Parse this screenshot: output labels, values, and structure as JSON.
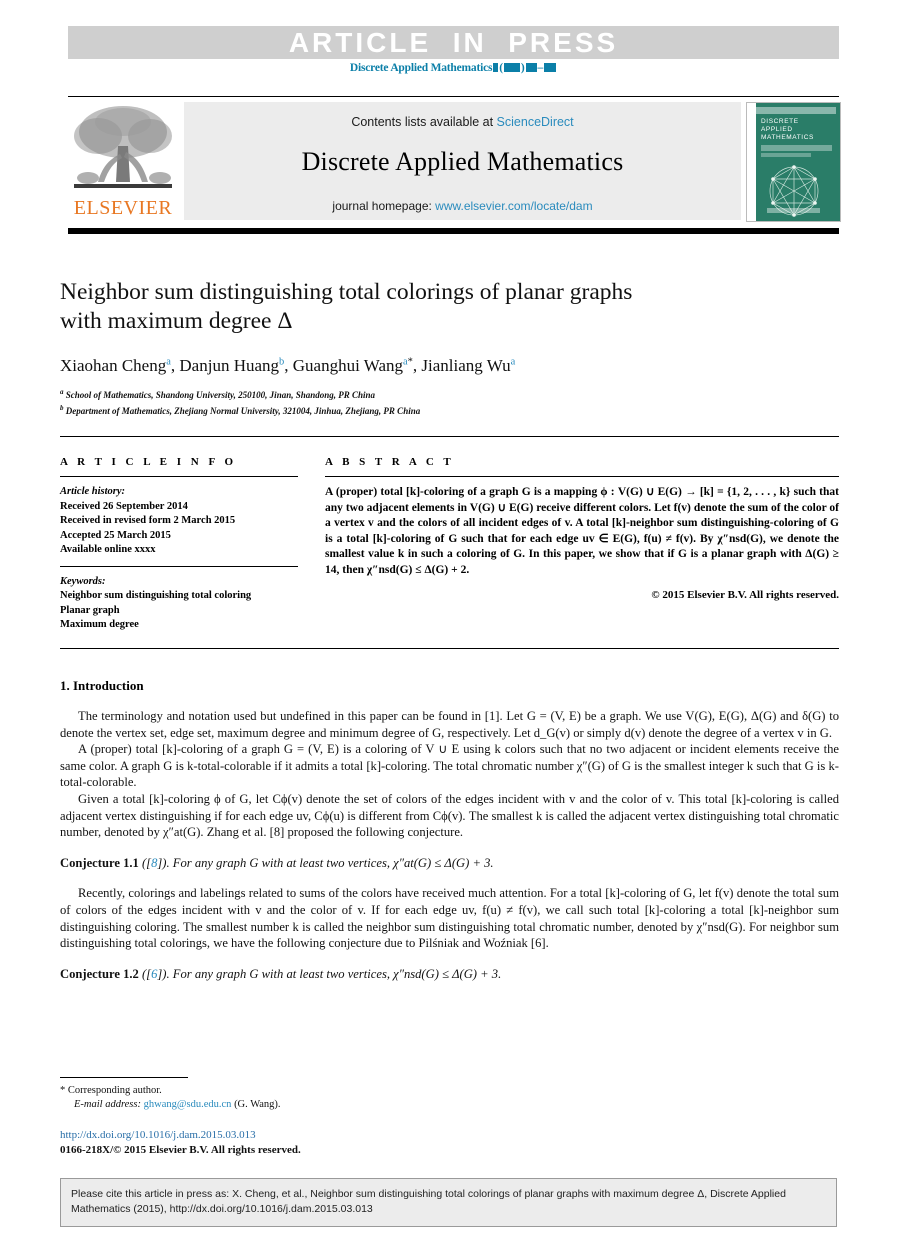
{
  "banner": {
    "article_in_press": "ARTICLE  IN  PRESS",
    "journal_ref_prefix": "Discrete Applied Mathematics"
  },
  "masthead": {
    "contents_prefix": "Contents lists available at ",
    "contents_link": "ScienceDirect",
    "journal_title": "Discrete Applied Mathematics",
    "homepage_prefix": "journal homepage: ",
    "homepage_link": "www.elsevier.com/locate/dam",
    "publisher_logo_text": "ELSEVIER",
    "cover_title_line1": "DISCRETE",
    "cover_title_line2": "APPLIED",
    "cover_title_line3": "MATHEMATICS",
    "cover_color": "#2a7d68"
  },
  "article": {
    "title_line1": "Neighbor sum distinguishing total colorings of planar graphs",
    "title_line2": "with maximum degree Δ",
    "authors": [
      {
        "name": "Xiaohan Cheng",
        "marks": "a",
        "star": false
      },
      {
        "name": "Danjun Huang",
        "marks": "b",
        "star": false
      },
      {
        "name": "Guanghui Wang",
        "marks": "a",
        "star": true
      },
      {
        "name": "Jianliang Wu",
        "marks": "a",
        "star": false
      }
    ],
    "affiliations": [
      {
        "mark": "a",
        "text": "School of Mathematics, Shandong University, 250100, Jinan, Shandong, PR China"
      },
      {
        "mark": "b",
        "text": "Department of Mathematics, Zhejiang Normal University, 321004, Jinhua, Zhejiang, PR China"
      }
    ]
  },
  "article_info": {
    "heading": "A R T I C L E   I N F O",
    "history_label": "Article history:",
    "history": [
      "Received 26 September 2014",
      "Received in revised form 2 March 2015",
      "Accepted 25 March 2015",
      "Available online xxxx"
    ],
    "keywords_label": "Keywords:",
    "keywords": [
      "Neighbor sum distinguishing total coloring",
      "Planar graph",
      "Maximum degree"
    ]
  },
  "abstract": {
    "heading": "A B S T R A C T",
    "text_part1": "A (proper) total [k]-coloring of a graph ",
    "text": "A (proper) total [k]-coloring of a graph G is a mapping ϕ : V(G) ∪ E(G) → [k] = {1, 2, . . . , k} such that any two adjacent elements in V(G) ∪ E(G) receive different colors. Let f(v) denote the sum of the color of a vertex v and the colors of all incident edges of v. A total [k]-neighbor sum distinguishing-coloring of G is a total [k]-coloring of G such that for each edge uv ∈ E(G), f(u) ≠ f(v). By χ″nsd(G), we denote the smallest value k in such a coloring of G. In this paper, we show that if G is a planar graph with Δ(G) ≥ 14, then χ″nsd(G) ≤ Δ(G) + 2.",
    "copyright": "© 2015 Elsevier B.V. All rights reserved."
  },
  "body": {
    "section_heading": "1.  Introduction",
    "p1": "The terminology and notation used but undefined in this paper can be found in [1]. Let G = (V, E) be a graph. We use V(G), E(G), Δ(G) and δ(G) to denote the vertex set, edge set, maximum degree and minimum degree of G, respectively. Let d_G(v) or simply d(v) denote the degree of a vertex v in G.",
    "p2": "A (proper) total [k]-coloring of a graph G = (V, E) is a coloring of V ∪ E using k colors such that no two adjacent or incident elements receive the same color. A graph G is k-total-colorable if it admits a total [k]-coloring. The total chromatic number χ″(G) of G is the smallest integer k such that G is k-total-colorable.",
    "p3": "Given a total [k]-coloring ϕ of G, let Cϕ(v) denote the set of colors of the edges incident with v and the color of v. This total [k]-coloring is called adjacent vertex distinguishing if for each edge uv, Cϕ(u) is different from Cϕ(v). The smallest k is called the adjacent vertex distinguishing total chromatic number, denoted by χ″at(G). Zhang et al. [8] proposed the following conjecture.",
    "conjecture1_label": "Conjecture 1.1",
    "conjecture1_ref": "8",
    "conjecture1_text": "For any graph G with at least two vertices, χ″at(G) ≤ Δ(G) + 3.",
    "p4": "Recently, colorings and labelings related to sums of the colors have received much attention. For a total [k]-coloring of G, let f(v) denote the total sum of colors of the edges incident with v and the color of v. If for each edge uv, f(u) ≠ f(v), we call such total [k]-coloring a total [k]-neighbor sum distinguishing coloring. The smallest number k is called the neighbor sum distinguishing total chromatic number, denoted by χ″nsd(G). For neighbor sum distinguishing total colorings, we have the following conjecture due to Pilśniak and Woźniak [6].",
    "conjecture2_label": "Conjecture 1.2",
    "conjecture2_ref": "6",
    "conjecture2_text": "For any graph G with at least two vertices, χ″nsd(G) ≤ Δ(G) + 3."
  },
  "footer": {
    "corresponding_mark": "*",
    "corresponding_text": "Corresponding author.",
    "email_label": "E-mail address:",
    "email": "ghwang@sdu.edu.cn",
    "email_suffix": "(G. Wang).",
    "doi_url": "http://dx.doi.org/10.1016/j.dam.2015.03.013",
    "issn_line": "0166-218X/© 2015 Elsevier B.V. All rights reserved."
  },
  "cite_box": {
    "text": "Please cite this article in press as: X. Cheng, et al., Neighbor sum distinguishing total colorings of planar graphs with maximum degree Δ, Discrete Applied Mathematics (2015), http://dx.doi.org/10.1016/j.dam.2015.03.013"
  },
  "colors": {
    "banner_gray": "#cfcfcf",
    "link_blue": "#2a8bbd",
    "journal_teal": "#0b7fa8",
    "elsevier_orange": "#e87722",
    "masthead_gray": "#ececec"
  }
}
